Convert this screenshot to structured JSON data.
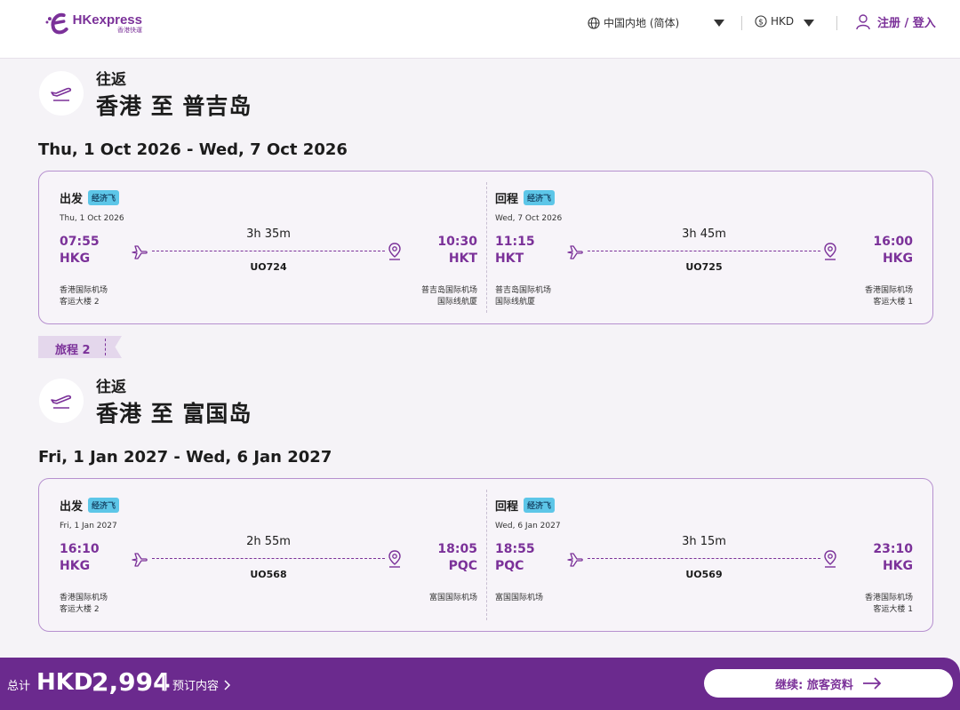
{
  "header": {
    "logo_brand": "HKexpress",
    "logo_cn": "香港快運",
    "language": "中国内地 (简体)",
    "currency": "HKD",
    "login": "注册 / 登入"
  },
  "trips": [
    {
      "type": "往返",
      "route": "香港 至 普吉岛",
      "date_range": "Thu, 1 Oct 2026 - Wed, 7 Oct 2026",
      "legs": [
        {
          "title": "出发",
          "badge": "经济飞",
          "date": "Thu, 1 Oct 2026",
          "dep_time": "07:55",
          "dep_code": "HKG",
          "arr_time": "10:30",
          "arr_code": "HKT",
          "duration": "3h 35m",
          "flight": "UO724",
          "dep_airport": "香港国际机场",
          "dep_terminal": "客运大楼 2",
          "arr_airport": "普吉岛国际机场",
          "arr_terminal": "国际线航厦"
        },
        {
          "title": "回程",
          "badge": "经济飞",
          "date": "Wed, 7 Oct 2026",
          "dep_time": "11:15",
          "dep_code": "HKT",
          "arr_time": "16:00",
          "arr_code": "HKG",
          "duration": "3h 45m",
          "flight": "UO725",
          "dep_airport": "普吉岛国际机场",
          "dep_terminal": "国际线航厦",
          "arr_airport": "香港国际机场",
          "arr_terminal": "客运大楼 1"
        }
      ]
    },
    {
      "tag": "旅程 2",
      "type": "往返",
      "route": "香港 至 富国岛",
      "date_range": "Fri, 1 Jan 2027 - Wed, 6 Jan 2027",
      "legs": [
        {
          "title": "出发",
          "badge": "经济飞",
          "date": "Fri, 1 Jan 2027",
          "dep_time": "16:10",
          "dep_code": "HKG",
          "arr_time": "18:05",
          "arr_code": "PQC",
          "duration": "2h 55m",
          "flight": "UO568",
          "dep_airport": "香港国际机场",
          "dep_terminal": "客运大楼 2",
          "arr_airport": "富国国际机场",
          "arr_terminal": ""
        },
        {
          "title": "回程",
          "badge": "经济飞",
          "date": "Wed, 6 Jan 2027",
          "dep_time": "18:55",
          "dep_code": "PQC",
          "arr_time": "23:10",
          "arr_code": "HKG",
          "duration": "3h 15m",
          "flight": "UO569",
          "dep_airport": "富国国际机场",
          "dep_terminal": "",
          "arr_airport": "香港国际机场",
          "arr_terminal": "客运大楼 1"
        }
      ]
    }
  ],
  "footer": {
    "total_label": "总计",
    "currency": "HKD",
    "amount": "2,994",
    "booking_details": "预订内容",
    "continue": "继续: 旅客资料"
  },
  "colors": {
    "brand": "#7b3199",
    "footer_bg": "#6b2a8e",
    "badge": "#5dc6e8"
  }
}
